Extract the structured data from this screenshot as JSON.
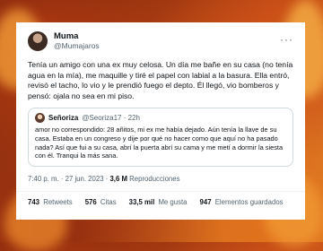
{
  "author": {
    "display_name": "Muma",
    "handle": "@Mumajaros"
  },
  "tweet": {
    "text": "Tenía un amigo con una ex muy celosa. Un día me bañe en su casa (no tenía agua en la mía), me maquille y tiré el papel con labial a la basura. Ella entró, revisó el tacho, lo vio y le prendió fuego el depto. Él llegó, vio bomberos y pensó: ojala no sea en mi piso.",
    "time": "7:40 p. m.",
    "date": "27 jun. 2023",
    "views_count": "3,6 M",
    "views_label": "Reproducciones"
  },
  "quoted": {
    "display_name": "Señoriza",
    "handle": "@Seoriza17",
    "age": "22h",
    "text": "amor no correspondido: 28 añitos, mi ex me había dejado. Aún tenía la llave de su casa. Estaba en un congreso y dije por qué no hacer como que aquí no ha pasado nada? Así que fui a su casa, abrí la puerta abrí su cama y me metí a dormir la siesta con él. Tranqui la más sana."
  },
  "stats": {
    "retweets_count": "743",
    "retweets_label": "Retweets",
    "quotes_count": "576",
    "quotes_label": "Citas",
    "likes_count": "33,5 mil",
    "likes_label": "Me gusta",
    "bookmarks_count": "947",
    "bookmarks_label": "Elementos guardados"
  },
  "icons": {
    "more": "more-options-icon"
  }
}
